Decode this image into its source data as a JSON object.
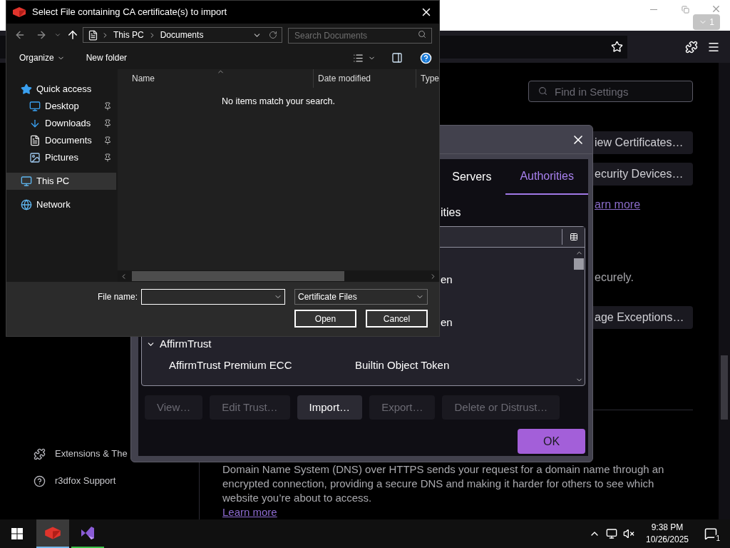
{
  "browser": {
    "tab_count_badge": "1",
    "settings_search": {
      "placeholder": "Find in Settings"
    },
    "certificate_buttons": [
      {
        "label": "iew Certificates…"
      },
      {
        "label": "ecurity Devices…"
      }
    ],
    "learn_more_fragment": "arn more",
    "text_fragment": "ecurely.",
    "exceptions_button": "age Exceptions…",
    "sidebar": [
      {
        "kind": "extensions",
        "label": "Extensions & The"
      },
      {
        "kind": "support",
        "label": "r3dfox Support"
      }
    ],
    "dns_description": "Domain Name System (DNS) over HTTPS sends your request for a domain name through an encrypted connection, providing a secure DNS and making it harder for others to see which website you’re about to access.",
    "learn_more": "Learn more"
  },
  "certificate_manager": {
    "tabs": [
      {
        "label": "Servers",
        "selected": false
      },
      {
        "label": "Authorities",
        "selected": true
      }
    ],
    "heading_fragment": "ities",
    "rows": [
      {
        "kind": "cert",
        "column_2": "en"
      },
      {
        "kind": "cert",
        "column_2": "en"
      },
      {
        "kind": "group",
        "label": "AffirmTrust",
        "expanded": true,
        "children": [
          {
            "name": "AffirmTrust Premium ECC",
            "token": "Builtin Object Token"
          }
        ]
      }
    ],
    "buttons": [
      {
        "label": "View…",
        "disabled": true
      },
      {
        "label": "Edit Trust…",
        "disabled": true
      },
      {
        "label": "Import…",
        "disabled": false
      },
      {
        "label": "Export…",
        "disabled": true
      },
      {
        "label": "Delete or Distrust…",
        "disabled": true
      }
    ],
    "ok_button": "OK"
  },
  "file_dialog": {
    "title": "Select File containing CA certificate(s) to import",
    "breadcrumb": [
      {
        "label": "This PC"
      },
      {
        "label": "Documents"
      }
    ],
    "search": {
      "placeholder": "Search Documents"
    },
    "commands": [
      {
        "label": "Organize",
        "has_menu": true
      },
      {
        "label": "New folder",
        "has_menu": false
      }
    ],
    "nav": [
      {
        "label": "Quick access",
        "kind": "star",
        "selected": false,
        "children": [
          {
            "label": "Desktop",
            "kind": "desktop",
            "pinned": true,
            "selected": false
          },
          {
            "label": "Downloads",
            "kind": "download",
            "pinned": true,
            "selected": false
          },
          {
            "label": "Documents",
            "kind": "document",
            "pinned": true,
            "selected": false
          },
          {
            "label": "Pictures",
            "kind": "picture",
            "pinned": true,
            "selected": false
          }
        ]
      },
      {
        "label": "This PC",
        "kind": "computer",
        "selected": true
      },
      {
        "label": "Network",
        "kind": "network",
        "selected": false
      }
    ],
    "columns": [
      {
        "label": "Name",
        "sorted": true
      },
      {
        "label": "Date modified",
        "sorted": false
      },
      {
        "label": "Type",
        "sorted": false
      }
    ],
    "empty_message": "No items match your search.",
    "file_name_label": "File name:",
    "file_type": "Certificate Files",
    "buttons": [
      {
        "label": "Open"
      },
      {
        "label": "Cancel"
      }
    ]
  },
  "taskbar": {
    "apps": [
      {
        "kind": "browser",
        "selected": true
      },
      {
        "kind": "editor",
        "selected": false
      }
    ],
    "time": "9:38 PM",
    "date": "10/26/2025",
    "notification_count": "1"
  }
}
